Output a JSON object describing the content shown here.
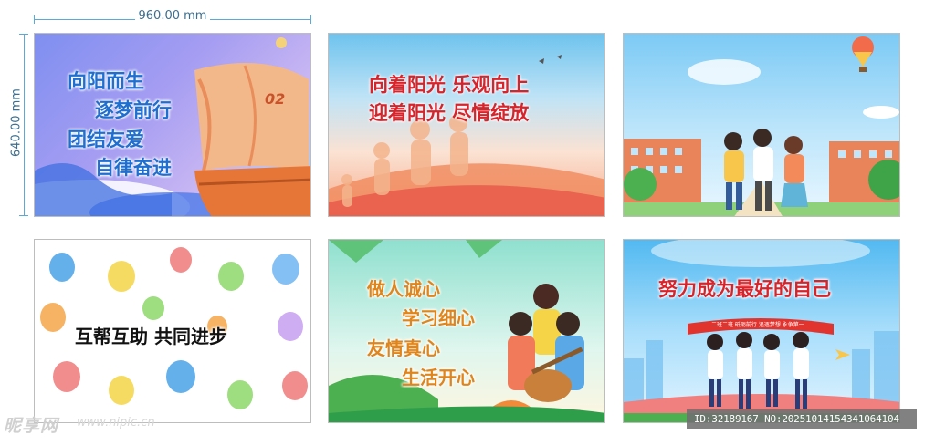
{
  "dimensions": {
    "width_label": "960.00 mm",
    "height_label": "640.00 mm"
  },
  "panels": [
    {
      "lines": [
        "向阳而生",
        "逐梦前行",
        "团结友爱",
        "自律奋进"
      ],
      "sail_number": "02"
    },
    {
      "lines": [
        "向着阳光  乐观向上",
        "迎着阳光  尽情绽放"
      ]
    },
    {
      "lines": []
    },
    {
      "lines": [
        "互帮互助  共同进步"
      ]
    },
    {
      "lines": [
        "做人诚心",
        "学习细心",
        "友情真心",
        "生活开心"
      ]
    },
    {
      "lines": [
        "努力成为最好的自己"
      ],
      "banner": "二班二班  砥砺前行  追逐梦想  永争第一"
    }
  ],
  "watermark": {
    "logo": "昵享网",
    "url": "www.nipic.cn",
    "id": "ID:32189167 NO:20251014154341064104"
  },
  "colors": {
    "blue_title": "#1e6fd0",
    "red_title": "#d8232a",
    "orange_title": "#e0851b",
    "black_title": "#111111"
  }
}
